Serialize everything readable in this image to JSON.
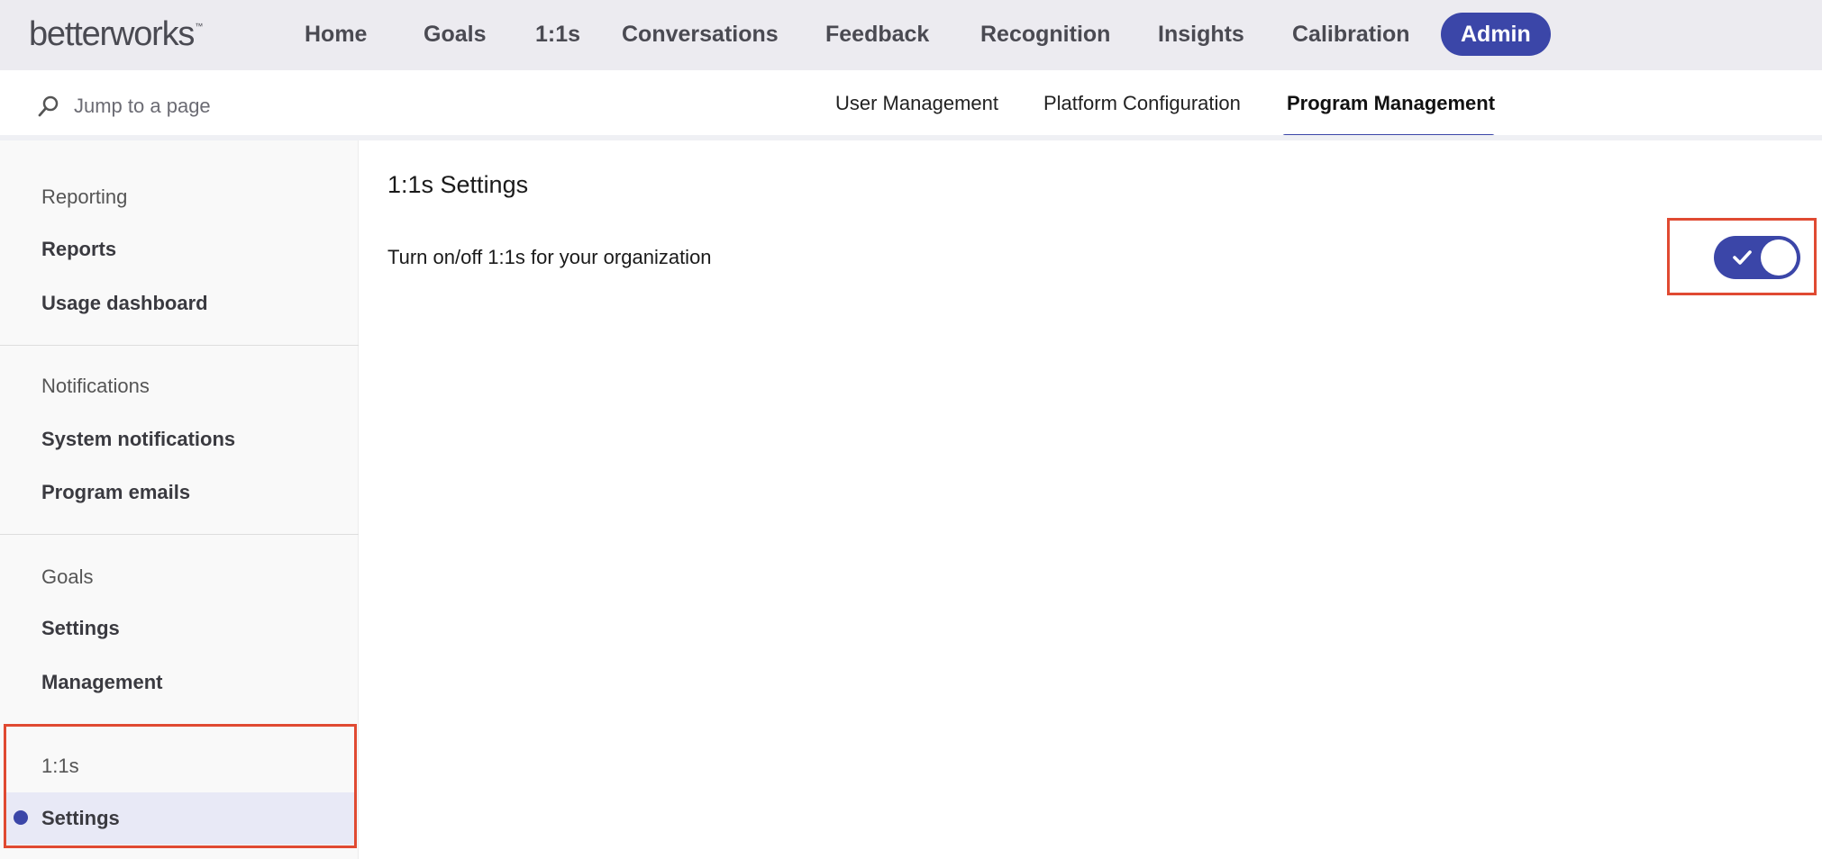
{
  "brand": {
    "logo_text": "betterworks",
    "trademark": "™",
    "accent_color": "#3b46a8",
    "annotation_color": "#e04a32"
  },
  "topnav": {
    "items": [
      "Home",
      "Goals",
      "1:1s",
      "Conversations",
      "Feedback",
      "Recognition",
      "Insights",
      "Calibration",
      "Admin"
    ],
    "active": "Admin"
  },
  "search": {
    "icon": "search-icon",
    "placeholder": "Jump to a page"
  },
  "subtabs": {
    "items": [
      "User Management",
      "Platform Configuration",
      "Program Management"
    ],
    "active": "Program Management"
  },
  "sidebar": {
    "sections": [
      {
        "title": "Reporting",
        "links": [
          "Reports",
          "Usage dashboard"
        ]
      },
      {
        "title": "Notifications",
        "links": [
          "System notifications",
          "Program emails"
        ]
      },
      {
        "title": "Goals",
        "links": [
          "Settings",
          "Management"
        ]
      },
      {
        "title": "1:1s",
        "links": [
          "Settings"
        ]
      }
    ],
    "active_section": "1:1s",
    "active_link": "Settings"
  },
  "main": {
    "title": "1:1s Settings",
    "setting_label": "Turn on/off 1:1s for your organization",
    "toggle_state": "on",
    "toggle_icon": "check-icon"
  }
}
